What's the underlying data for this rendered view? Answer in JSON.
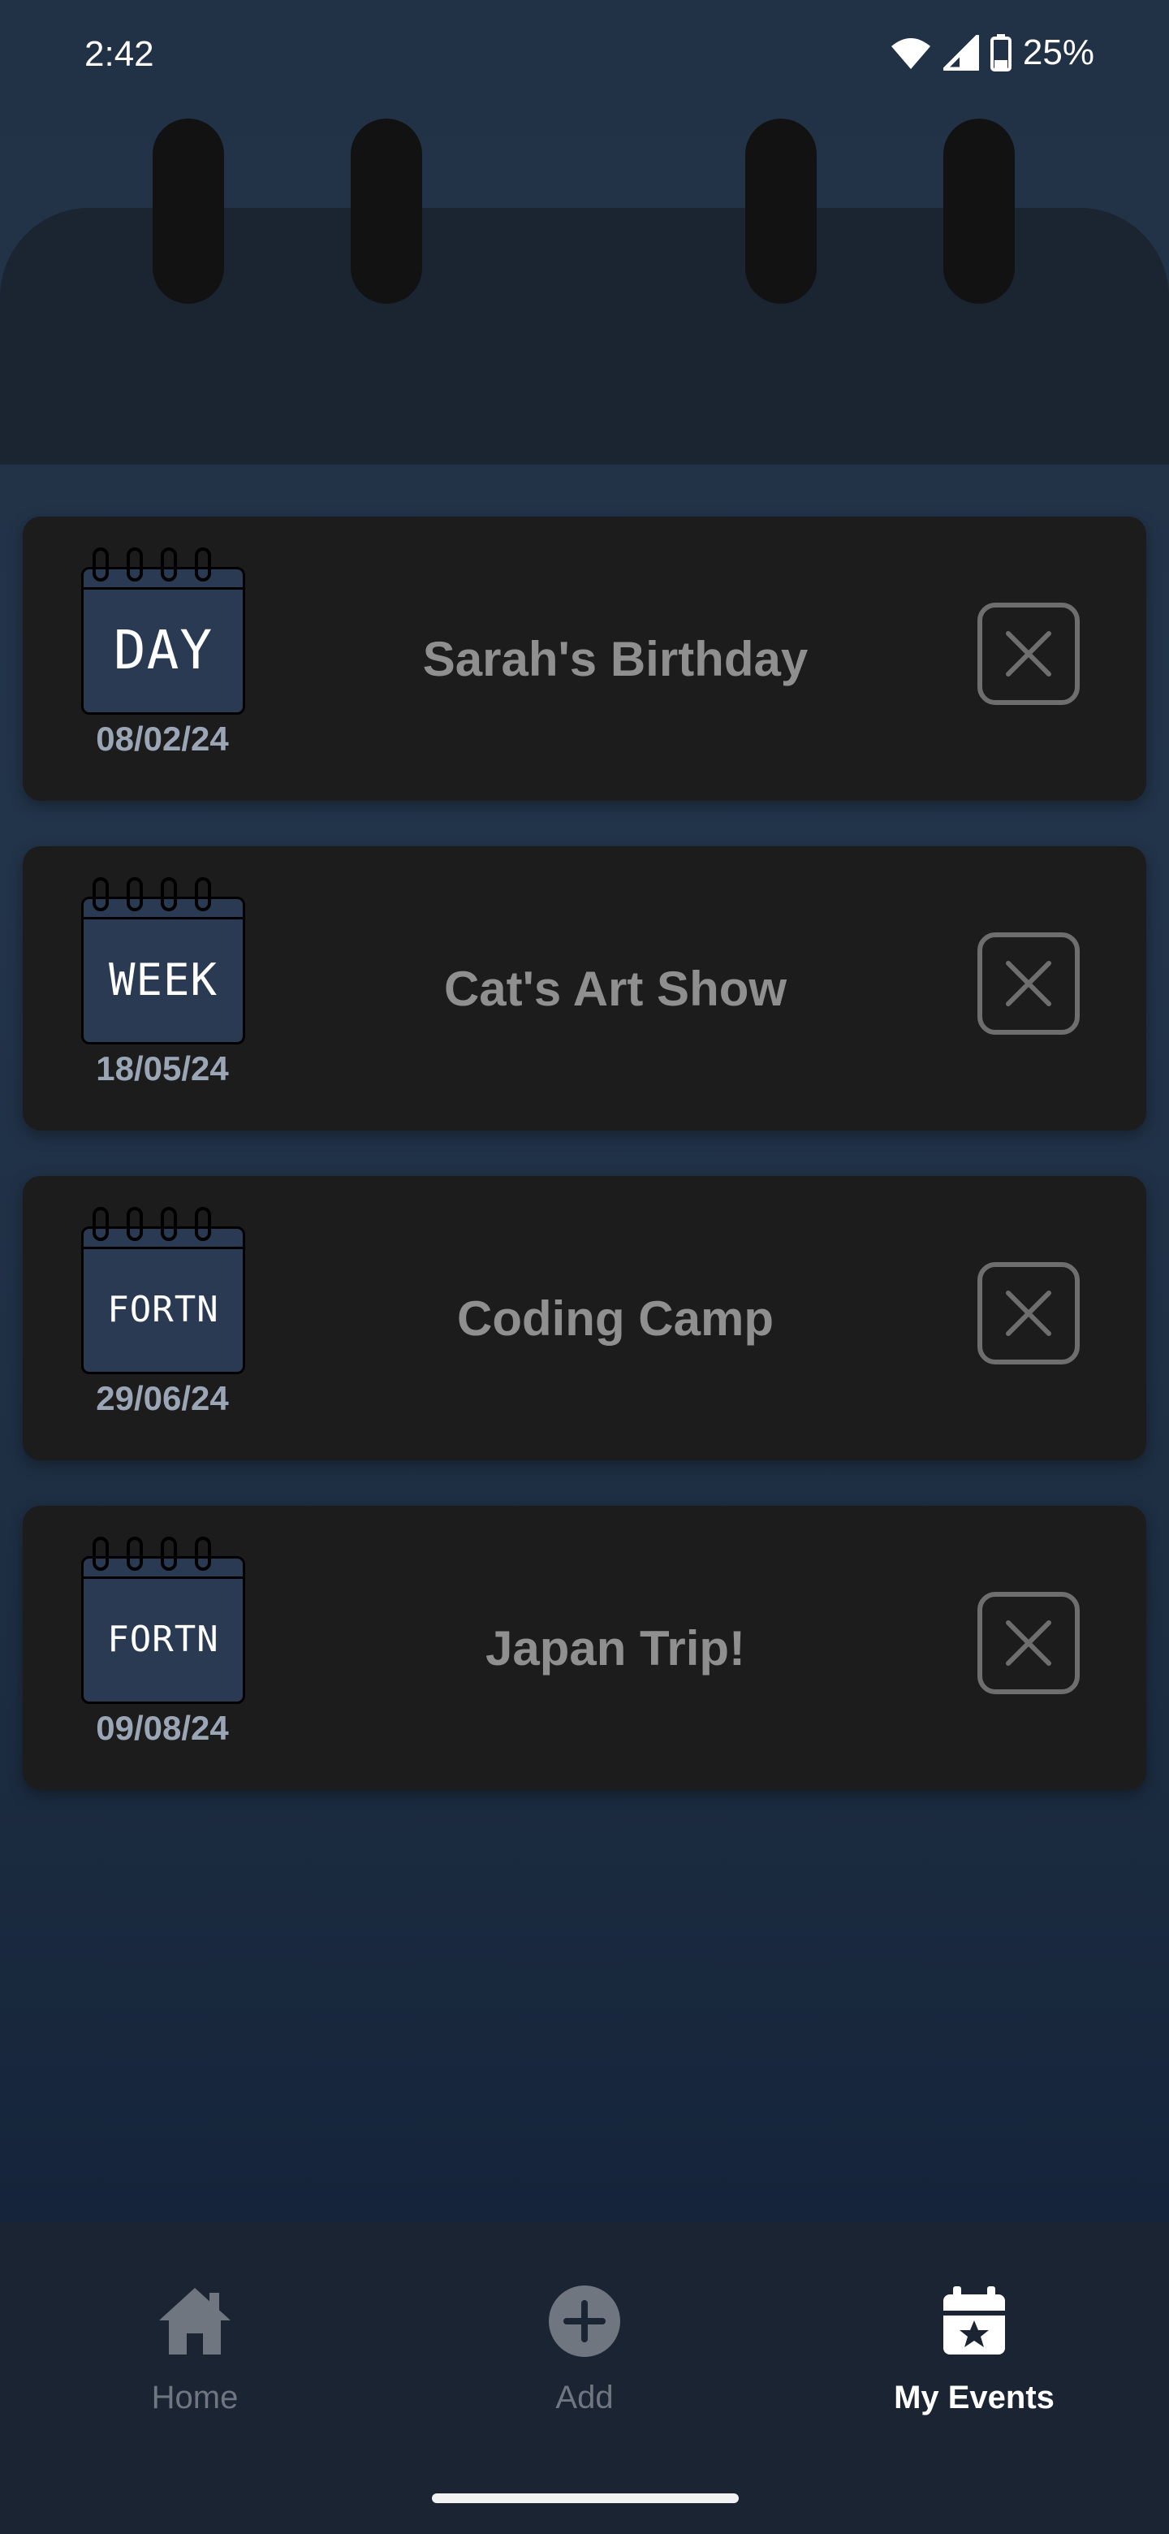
{
  "status_bar": {
    "time": "2:42",
    "battery": "25%"
  },
  "events": [
    {
      "period": "DAY",
      "date": "08/02/24",
      "title": "Sarah's Birthday"
    },
    {
      "period": "WEEK",
      "date": "18/05/24",
      "title": "Cat's Art Show"
    },
    {
      "period": "FORTN",
      "date": "29/06/24",
      "title": "Coding Camp"
    },
    {
      "period": "FORTN",
      "date": "09/08/24",
      "title": "Japan Trip!"
    }
  ],
  "nav": {
    "items": [
      {
        "label": "Home",
        "icon": "home-icon",
        "active": false
      },
      {
        "label": "Add",
        "icon": "add-circle-icon",
        "active": false
      },
      {
        "label": "My Events",
        "icon": "calendar-star-icon",
        "active": true
      }
    ]
  },
  "colors": {
    "accent": "#ffffff",
    "card": "#1c1c1c",
    "calendar": "#2a3a52",
    "background": "#22344a"
  }
}
